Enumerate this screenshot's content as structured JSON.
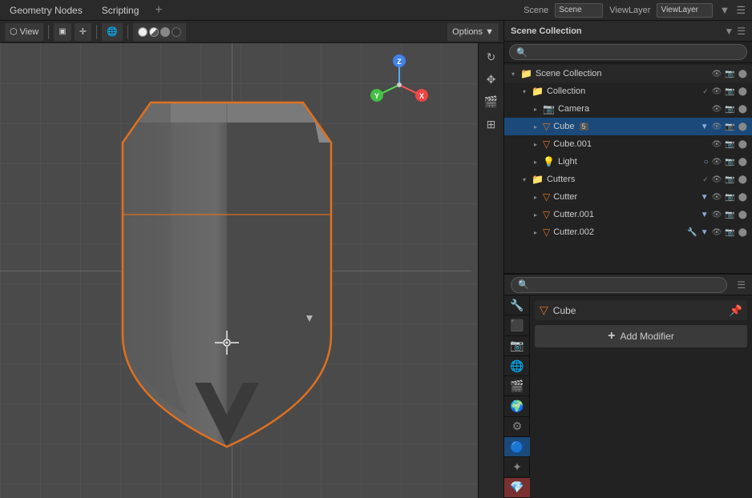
{
  "topMenu": {
    "items": [
      "Geometry Nodes",
      "Scripting"
    ],
    "addTab": "+"
  },
  "viewport": {
    "toolbarItems": [
      {
        "label": "⬡",
        "id": "view-menu"
      },
      {
        "label": "▣ ▼",
        "id": "viewport-shading"
      },
      {
        "label": "🌐",
        "id": "overlay"
      },
      {
        "label": "⬜⬜",
        "id": "viewport-mode"
      },
      {
        "label": "● ◐ ○",
        "id": "shading-options"
      },
      {
        "label": "Options ▼",
        "id": "options"
      }
    ],
    "rightTools": [
      {
        "icon": "↻",
        "name": "rotate-tool"
      },
      {
        "icon": "✥",
        "name": "move-tool"
      },
      {
        "icon": "🎬",
        "name": "camera-tool"
      },
      {
        "icon": "⊞",
        "name": "grid-tool"
      }
    ]
  },
  "outliner": {
    "title": "Scene Collection",
    "searchPlaceholder": "",
    "items": [
      {
        "type": "scene-collection",
        "label": "Scene Collection",
        "indent": 0,
        "icon": "collection",
        "expanded": true
      },
      {
        "type": "collection",
        "label": "Collection",
        "indent": 1,
        "icon": "collection",
        "expanded": true,
        "hasEye": true,
        "hasCam": true,
        "hasRender": true
      },
      {
        "type": "object",
        "label": "Camera",
        "indent": 2,
        "icon": "camera",
        "selected": false,
        "hasEye": true,
        "hasCam": true,
        "hasRender": true
      },
      {
        "type": "object",
        "label": "Cube",
        "indent": 2,
        "icon": "mesh",
        "selected": true,
        "badge": "5",
        "hasFilter": true,
        "hasEye": true,
        "hasCam": true,
        "hasRender": true
      },
      {
        "type": "object",
        "label": "Cube.001",
        "indent": 2,
        "icon": "mesh",
        "selected": false,
        "hasEye": true,
        "hasCam": true,
        "hasRender": true
      },
      {
        "type": "object",
        "label": "Light",
        "indent": 2,
        "icon": "light",
        "selected": false,
        "hasFilter": true,
        "hasEye": true,
        "hasCam": true,
        "hasRender": true
      },
      {
        "type": "collection",
        "label": "Cutters",
        "indent": 1,
        "icon": "collection",
        "expanded": true,
        "hasEye": true,
        "hasCam": true,
        "hasRender": true
      },
      {
        "type": "object",
        "label": "Cutter",
        "indent": 2,
        "icon": "mesh",
        "selected": false,
        "hasFilter": true,
        "hasEye": true,
        "hasCam": true,
        "hasRender": true
      },
      {
        "type": "object",
        "label": "Cutter.001",
        "indent": 2,
        "icon": "mesh",
        "selected": false,
        "hasFilter": true,
        "hasEye": true,
        "hasCam": true,
        "hasRender": true
      },
      {
        "type": "object",
        "label": "Cutter.002",
        "indent": 2,
        "icon": "mesh",
        "selected": false,
        "hasFilter2": true,
        "hasEye": true,
        "hasCam": true,
        "hasRender": true
      }
    ]
  },
  "properties": {
    "searchPlaceholder": "",
    "objectName": "Cube",
    "addModifierLabel": "Add Modifier",
    "tabs": [
      {
        "icon": "🔧",
        "label": "active-tool",
        "active": false
      },
      {
        "icon": "⬛",
        "label": "render",
        "active": false
      },
      {
        "icon": "📷",
        "label": "output",
        "active": false
      },
      {
        "icon": "🌐",
        "label": "view-layer",
        "active": false
      },
      {
        "icon": "🎬",
        "label": "scene",
        "active": false
      },
      {
        "icon": "🌍",
        "label": "world",
        "active": false
      },
      {
        "icon": "⚙",
        "label": "object",
        "active": false
      },
      {
        "icon": "🔵",
        "label": "modifier",
        "active": true
      },
      {
        "icon": "✦",
        "label": "particles",
        "active": false
      },
      {
        "icon": "💎",
        "label": "material",
        "active": false
      }
    ]
  },
  "colors": {
    "selected": "#1b4a7a",
    "accent": "#e07020",
    "background": "#222222",
    "viewport": "#4a4a4a"
  }
}
